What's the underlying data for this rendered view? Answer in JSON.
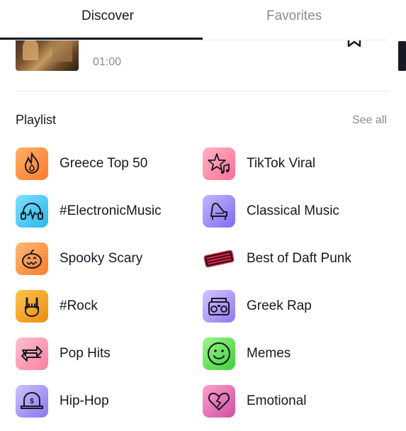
{
  "tabs": [
    {
      "label": "Discover",
      "active": true
    },
    {
      "label": "Favorites",
      "active": false
    }
  ],
  "current_track": {
    "duration": "01:00",
    "bookmark_icon": "bookmark-icon"
  },
  "playlist_section": {
    "title": "Playlist",
    "see_all": "See all"
  },
  "playlists": [
    {
      "label": "Greece Top 50",
      "icon": "flame-icon",
      "color": "#ff8a3d"
    },
    {
      "label": "TikTok Viral",
      "icon": "star-music-icon",
      "color": "#ff7aa0"
    },
    {
      "label": "#ElectronicMusic",
      "icon": "headphones-icon",
      "color": "#4cc9f0"
    },
    {
      "label": "Classical Music",
      "icon": "piano-icon",
      "color": "#8f7cf0"
    },
    {
      "label": "Spooky Scary",
      "icon": "pumpkin-icon",
      "color": "#ff8c42"
    },
    {
      "label": "Best of Daft Punk",
      "icon": "daft-punk-logo-icon",
      "color": "#e8213a"
    },
    {
      "label": "#Rock",
      "icon": "rock-hand-icon",
      "color": "#f2a024"
    },
    {
      "label": "Greek Rap",
      "icon": "boombox-icon",
      "color": "#a38bf0"
    },
    {
      "label": "Pop Hits",
      "icon": "arrows-icon",
      "color": "#ff85a8"
    },
    {
      "label": "Memes",
      "icon": "smiley-icon",
      "color": "#5de05a"
    },
    {
      "label": "Hip-Hop",
      "icon": "cap-icon",
      "color": "#8f7cf0"
    },
    {
      "label": "Emotional",
      "icon": "broken-heart-icon",
      "color": "#f06aa8"
    }
  ]
}
